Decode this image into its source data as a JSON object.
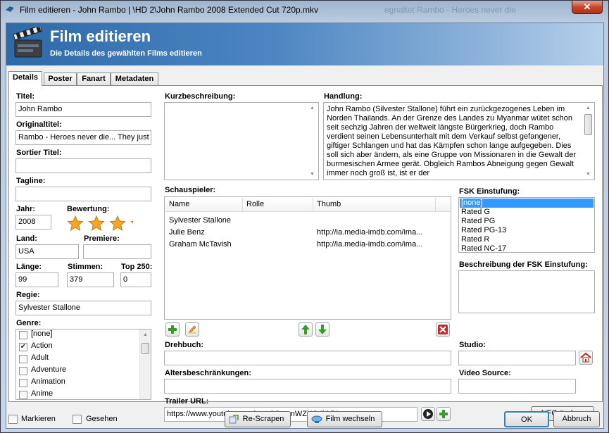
{
  "window": {
    "title": "Film editieren - John Rambo | \\HD 2\\John Rambo 2008 Extended Cut 720p.mkv",
    "background_title": "egnaltet Rambo - Heroes never die",
    "close_label": "✕"
  },
  "banner": {
    "title": "Film editieren",
    "subtitle": "Die Details des gewählten Films editieren"
  },
  "tabs": [
    {
      "label": "Details",
      "active": true
    },
    {
      "label": "Poster",
      "active": false
    },
    {
      "label": "Fanart",
      "active": false
    },
    {
      "label": "Metadaten",
      "active": false
    }
  ],
  "details": {
    "title_label": "Titel:",
    "title_value": "John Rambo",
    "original_title_label": "Originaltitel:",
    "original_title_value": "Rambo - Heroes never die... They just",
    "sort_title_label": "Sortier Titel:",
    "sort_title_value": "",
    "tagline_label": "Tagline:",
    "tagline_value": "",
    "year_label": "Jahr:",
    "year_value": "2008",
    "rating_label": "Bewertung:",
    "rating_stars": 3.5,
    "country_label": "Land:",
    "country_value": "USA",
    "premiere_label": "Premiere:",
    "premiere_value": "",
    "length_label": "Länge:",
    "length_value": "99",
    "votes_label": "Stimmen:",
    "votes_value": "379",
    "top250_label": "Top 250:",
    "top250_value": "0",
    "director_label": "Regie:",
    "director_value": "Sylvester Stallone",
    "genre_label": "Genre:",
    "genres": [
      {
        "label": "[none]",
        "checked": false
      },
      {
        "label": "Action",
        "checked": true
      },
      {
        "label": "Adult",
        "checked": false
      },
      {
        "label": "Adventure",
        "checked": false
      },
      {
        "label": "Animation",
        "checked": false
      },
      {
        "label": "Anime",
        "checked": false
      }
    ]
  },
  "middle": {
    "short_desc_label": "Kurzbeschreibung:",
    "short_desc_value": "",
    "actors_label": "Schauspieler:",
    "actor_columns": [
      "Name",
      "Rolle",
      "Thumb"
    ],
    "actors": [
      {
        "name": "Sylvester Stallone",
        "role": "",
        "thumb": ""
      },
      {
        "name": "Julie Benz",
        "role": "",
        "thumb": "http://ia.media-imdb.com/ima..."
      },
      {
        "name": "Graham McTavish",
        "role": "",
        "thumb": "http://ia.media-imdb.com/ima..."
      }
    ],
    "writer_label": "Drehbuch:",
    "writer_value": "",
    "age_restrictions_label": "Altersbeschränkungen:",
    "age_restrictions_value": "",
    "trailer_label": "Trailer URL:",
    "trailer_value": "https://www.youtube.com/watch?v=rnWZXQ4kbDI"
  },
  "plot": {
    "label": "Handlung:",
    "text": "John Rambo (Silvester Stallone) führt ein zurückgezogenes Leben im Norden Thailands. An der Grenze des Landes zu Myanmar wütet schon seit sechzig Jahren der weltweit längste Bürgerkrieg, doch Rambo verdient seinen Lebensunterhalt mit dem Verkauf selbst gefangener, giftiger Schlangen und hat das Kämpfen schon lange aufgegeben. Dies soll sich aber ändern, als eine Gruppe von Missionaren in die Gewalt der burmesischen Armee gerät. Obgleich Rambos Abneigung gegen Gewalt immer noch groß ist, ist er der"
  },
  "right": {
    "fsk_label": "FSK Einstufung:",
    "fsk_options": [
      "[none]",
      "Rated G",
      "Rated PG",
      "Rated PG-13",
      "Rated R",
      "Rated NC-17"
    ],
    "fsk_selected": 0,
    "fsk_desc_label": "Beschreibung der FSK Einstufung:",
    "studio_label": "Studio:",
    "studio_value": "",
    "video_source_label": "Video Source:",
    "video_source_value": "",
    "nfo_button": "NFO ändern"
  },
  "footer": {
    "mark_label": "Markieren",
    "seen_label": "Gesehen",
    "rescrape_button": "Re-Scrapen",
    "change_movie_button": "Film wechseln",
    "ok_button": "OK",
    "cancel_button": "Abbruch"
  },
  "colors": {
    "banner_start": "#2e6aa8",
    "banner_end": "#b7d0ea",
    "selection": "#3399ff",
    "star": "#f5a623",
    "add_green": "#3c9a2a",
    "delete_red": "#c62828"
  }
}
